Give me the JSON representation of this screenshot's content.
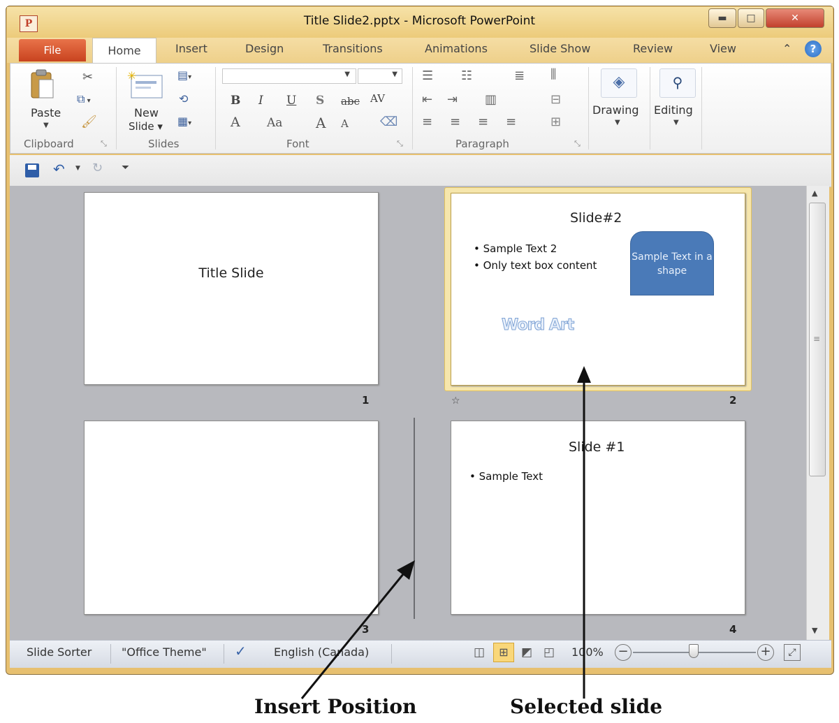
{
  "window": {
    "title": "Title Slide2.pptx - Microsoft PowerPoint",
    "app_icon": "P"
  },
  "window_controls": {
    "minimize": "▬",
    "maximize": "□",
    "close": "✕"
  },
  "tabs": [
    "File",
    "Home",
    "Insert",
    "Design",
    "Transitions",
    "Animations",
    "Slide Show",
    "Review",
    "View"
  ],
  "ribbon": {
    "clipboard": {
      "paste": "Paste",
      "group": "Clipboard"
    },
    "slides": {
      "new_slide_line1": "New",
      "new_slide_line2": "Slide ▾",
      "group": "Slides"
    },
    "font": {
      "bold": "B",
      "italic": "I",
      "underline": "U",
      "shadow": "S",
      "strike": "abc",
      "spacing": "AV",
      "font_color": "A",
      "change_case": "Aa",
      "grow": "A",
      "shrink": "A",
      "group": "Font"
    },
    "paragraph": {
      "group": "Paragraph"
    },
    "drawing": "Drawing",
    "editing": "Editing"
  },
  "slides": [
    {
      "number": "1",
      "title": "Title Slide"
    },
    {
      "number": "2",
      "title": "Slide#2",
      "bullets": [
        "Sample Text 2",
        "Only text box content"
      ],
      "shape_text": "Sample Text in a shape",
      "wordart": "Word Art",
      "transition_marker": "☆"
    },
    {
      "number": "3"
    },
    {
      "number": "4",
      "title": "Slide #1",
      "bullets": [
        "Sample Text"
      ]
    }
  ],
  "status": {
    "view_name": "Slide Sorter",
    "theme": "\"Office Theme\"",
    "language": "English (Canada)",
    "zoom": "100%"
  },
  "annotations": {
    "insert_position": "Insert Position",
    "selected_slide": "Selected slide"
  },
  "colors": {
    "accent_file_tab": "#d65a2f",
    "selection": "#f6e6ac",
    "shape_fill": "#4a7ab8",
    "wordart": "#8fb1dc"
  }
}
